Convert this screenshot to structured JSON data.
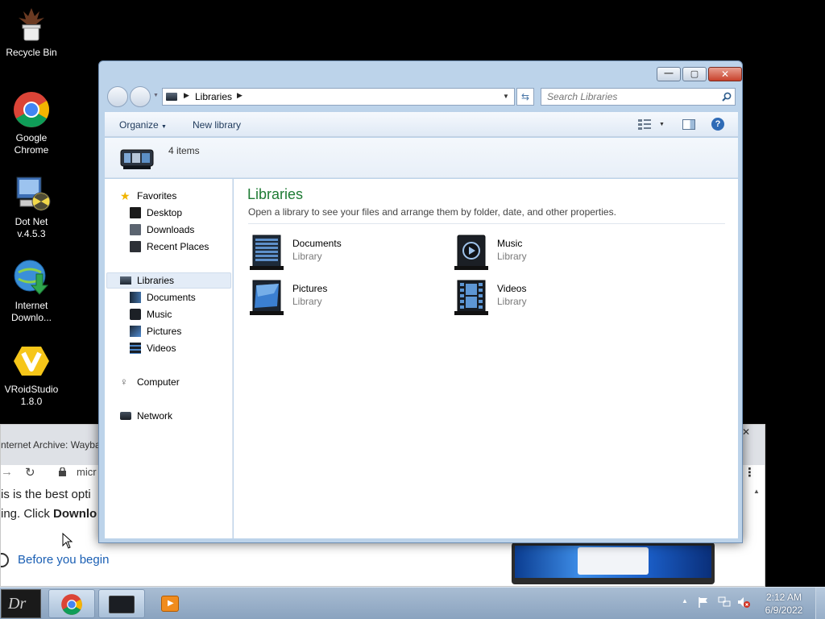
{
  "desktop": {
    "icons": [
      {
        "label1": "Recycle Bin",
        "label2": "",
        "icon": "recycle-bin-icon"
      },
      {
        "label1": "Google",
        "label2": "Chrome",
        "icon": "chrome-icon"
      },
      {
        "label1": "Dot Net",
        "label2": "v.4.5.3",
        "icon": "dotnet-installer-icon"
      },
      {
        "label1": "Internet",
        "label2": "Downlo...",
        "icon": "internet-download-manager-icon"
      },
      {
        "label1": "VRoidStudio",
        "label2": "1.8.0",
        "icon": "vroid-studio-icon"
      }
    ]
  },
  "background_browser": {
    "tab_title": "nternet Archive: Wayba",
    "url": "micr",
    "line1": "is is the best opti",
    "line2_a": "ing. Click ",
    "line2_b": "Downlo",
    "link": "Before you begin",
    "close_glyph": "✕",
    "menu_glyph": "⋮"
  },
  "explorer": {
    "title_buttons": {
      "min": "—",
      "max": "▢",
      "close": "✕"
    },
    "address": {
      "crumb": "Libraries"
    },
    "search": {
      "placeholder": "Search Libraries"
    },
    "commands": {
      "organize": "Organize",
      "new_library": "New library"
    },
    "info": {
      "count": "4 items"
    },
    "nav": {
      "favorites": "Favorites",
      "favorites_items": [
        "Desktop",
        "Downloads",
        "Recent Places"
      ],
      "libraries": "Libraries",
      "libraries_items": [
        "Documents",
        "Music",
        "Pictures",
        "Videos"
      ],
      "computer": "Computer",
      "network": "Network"
    },
    "main": {
      "title": "Libraries",
      "subtitle": "Open a library to see your files and arrange them by folder, date, and other properties.",
      "items": [
        {
          "name": "Documents",
          "type": "Library"
        },
        {
          "name": "Music",
          "type": "Library"
        },
        {
          "name": "Pictures",
          "type": "Library"
        },
        {
          "name": "Videos",
          "type": "Library"
        }
      ]
    }
  },
  "taskbar": {
    "time": "2:12 AM",
    "date": "6/9/2022"
  },
  "colors": {
    "library_title": "#1e7b34",
    "explorer_frame": "#bcd3ea",
    "taskbar": "#8aa3bf"
  }
}
